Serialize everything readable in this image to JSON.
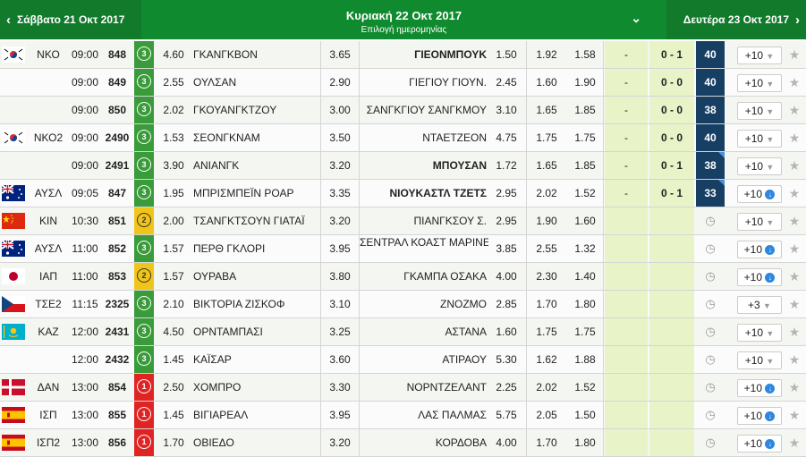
{
  "nav": {
    "prev_label": "Σάββατο 21 Οκτ 2017",
    "center_title": "Κυριακή 22 Οκτ 2017",
    "center_sub": "Επιλογή ημερομηνίας",
    "next_label": "Δευτέρα 23 Οκτ 2017",
    "prev_icon": "chevron-left-icon",
    "next_icon": "chevron-right-icon",
    "dropdown_icon": "double-chevron-down-icon"
  },
  "colors": {
    "header_green": "#0f8a2e",
    "minute_blue": "#173e63",
    "live_green": "#e8f3c8"
  },
  "rows": [
    {
      "flag": "kr",
      "league": "ΝΚΟ",
      "time": "09:00",
      "code": "848",
      "ev": "3",
      "o1": "4.60",
      "home": "ΓΚΑΝΓΚΒΟΝ",
      "ox": "3.65",
      "away": "ΓΙΕΟΝΜΠΟΥΚ",
      "away_bold": true,
      "o2": "1.50",
      "u1": "1.92",
      "u2": "1.58",
      "ht": "-",
      "score": "0 - 1",
      "minute": "40",
      "corner": false,
      "more": "+10",
      "more_type": "chevron",
      "star": "★"
    },
    {
      "flag": "",
      "league": "",
      "time": "09:00",
      "code": "849",
      "ev": "3",
      "o1": "2.55",
      "home": "ΟΥΛΣΑΝ",
      "ox": "2.90",
      "away": "ΓΙΕΓΙΟΥ ΓΙΟΥΝ.",
      "away_bold": false,
      "o2": "2.45",
      "u1": "1.60",
      "u2": "1.90",
      "ht": "-",
      "score": "0 - 0",
      "minute": "40",
      "corner": false,
      "more": "+10",
      "more_type": "chevron",
      "star": "★"
    },
    {
      "flag": "",
      "league": "",
      "time": "09:00",
      "code": "850",
      "ev": "3",
      "o1": "2.02",
      "home": "ΓΚΟΥΑΝΓΚΤΖΟΥ",
      "ox": "3.00",
      "away": "ΣΑΝΓΚΓΙΟΥ ΣΑΝΓΚΜΟΥ",
      "away_bold": false,
      "o2": "3.10",
      "u1": "1.65",
      "u2": "1.85",
      "ht": "-",
      "score": "0 - 0",
      "minute": "38",
      "corner": false,
      "more": "+10",
      "more_type": "chevron",
      "star": "★"
    },
    {
      "flag": "kr",
      "league": "ΝΚΟ2",
      "time": "09:00",
      "code": "2490",
      "ev": "3",
      "o1": "1.53",
      "home": "ΣΕΟΝΓΚΝΑΜ",
      "ox": "3.50",
      "away": "ΝΤΑΕΤΖΕΟΝ",
      "away_bold": false,
      "o2": "4.75",
      "u1": "1.75",
      "u2": "1.75",
      "ht": "-",
      "score": "0 - 0",
      "minute": "40",
      "corner": false,
      "more": "+10",
      "more_type": "chevron",
      "star": "★"
    },
    {
      "flag": "",
      "league": "",
      "time": "09:00",
      "code": "2491",
      "ev": "3",
      "o1": "3.90",
      "home": "ΑΝΙΑΝΓΚ",
      "ox": "3.20",
      "away": "ΜΠΟΥΣΑΝ",
      "away_bold": true,
      "o2": "1.72",
      "u1": "1.65",
      "u2": "1.85",
      "ht": "-",
      "score": "0 - 1",
      "minute": "38",
      "corner": true,
      "more": "+10",
      "more_type": "chevron",
      "star": "★"
    },
    {
      "flag": "au",
      "league": "ΑΥΣΛ",
      "time": "09:05",
      "code": "847",
      "ev": "3",
      "o1": "1.95",
      "home": "ΜΠΡΙΣΜΠΕΪΝ ΡΟΑΡ",
      "ox": "3.35",
      "away": "ΝΙΟΥΚΑΣΤΛ ΤΖΕΤΣ",
      "away_bold": true,
      "o2": "2.95",
      "u1": "2.02",
      "u2": "1.52",
      "ht": "-",
      "score": "0 - 1",
      "minute": "33",
      "corner": true,
      "more": "+10",
      "more_type": "info",
      "star": "★"
    },
    {
      "flag": "cn",
      "league": "ΚΙΝ",
      "time": "10:30",
      "code": "851",
      "ev": "2",
      "o1": "2.00",
      "home": "ΤΣΑΝΓΚΤΣΟΥΝ ΓΙΑΤΑΪ",
      "ox": "3.20",
      "away": "ΠΙΑΝΓΚΣΟΥ Σ.",
      "away_bold": false,
      "o2": "2.95",
      "u1": "1.90",
      "u2": "1.60",
      "ht": "",
      "score": "",
      "minute": "",
      "corner": false,
      "more": "+10",
      "more_type": "chevron",
      "star": "★"
    },
    {
      "flag": "au",
      "league": "ΑΥΣΛ",
      "time": "11:00",
      "code": "852",
      "ev": "3",
      "o1": "1.57",
      "home": "ΠΕΡΘ ΓΚΛΟΡΙ",
      "ox": "3.95",
      "away": "ΣΕΝΤΡΑΛ ΚΟΑΣΤ ΜΑΡΙΝΕΡΣ",
      "away_bold": false,
      "o2": "3.85",
      "u1": "2.55",
      "u2": "1.32",
      "ht": "",
      "score": "",
      "minute": "",
      "corner": false,
      "more": "+10",
      "more_type": "info",
      "star": "★"
    },
    {
      "flag": "jp",
      "league": "ΙΑΠ",
      "time": "11:00",
      "code": "853",
      "ev": "2",
      "o1": "1.57",
      "home": "ΟΥΡΑΒΑ",
      "ox": "3.80",
      "away": "ΓΚΑΜΠΑ ΟΣΑΚΑ",
      "away_bold": false,
      "o2": "4.00",
      "u1": "2.30",
      "u2": "1.40",
      "ht": "",
      "score": "",
      "minute": "",
      "corner": false,
      "more": "+10",
      "more_type": "info",
      "star": "★"
    },
    {
      "flag": "cz",
      "league": "ΤΣΕ2",
      "time": "11:15",
      "code": "2325",
      "ev": "3",
      "o1": "2.10",
      "home": "ΒΙΚΤΟΡΙΑ ΖΙΣΚΟΦ",
      "ox": "3.10",
      "away": "ΖΝΟΖΜΟ",
      "away_bold": false,
      "o2": "2.85",
      "u1": "1.70",
      "u2": "1.80",
      "ht": "",
      "score": "",
      "minute": "",
      "corner": false,
      "more": "+3",
      "more_type": "chevron",
      "star": "★"
    },
    {
      "flag": "kz",
      "league": "ΚΑΖ",
      "time": "12:00",
      "code": "2431",
      "ev": "3",
      "o1": "4.50",
      "home": "ΟΡΝΤΑΜΠΑΣΙ",
      "ox": "3.25",
      "away": "ΑΣΤΑΝΑ",
      "away_bold": false,
      "o2": "1.60",
      "u1": "1.75",
      "u2": "1.75",
      "ht": "",
      "score": "",
      "minute": "",
      "corner": false,
      "more": "+10",
      "more_type": "chevron",
      "star": "★"
    },
    {
      "flag": "",
      "league": "",
      "time": "12:00",
      "code": "2432",
      "ev": "3",
      "o1": "1.45",
      "home": "ΚΑΪΣΑΡ",
      "ox": "3.60",
      "away": "ΑΤΙΡΑΟΥ",
      "away_bold": false,
      "o2": "5.30",
      "u1": "1.62",
      "u2": "1.88",
      "ht": "",
      "score": "",
      "minute": "",
      "corner": false,
      "more": "+10",
      "more_type": "chevron",
      "star": "★"
    },
    {
      "flag": "dk",
      "league": "ΔΑΝ",
      "time": "13:00",
      "code": "854",
      "ev": "1",
      "o1": "2.50",
      "home": "ΧΟΜΠΡΟ",
      "ox": "3.30",
      "away": "ΝΟΡΝΤΖΕΛΑΝΤ",
      "away_bold": false,
      "o2": "2.25",
      "u1": "2.02",
      "u2": "1.52",
      "ht": "",
      "score": "",
      "minute": "",
      "corner": false,
      "more": "+10",
      "more_type": "info",
      "star": "★"
    },
    {
      "flag": "es",
      "league": "ΙΣΠ",
      "time": "13:00",
      "code": "855",
      "ev": "1",
      "o1": "1.45",
      "home": "ΒΙΓΙΑΡΕΑΛ",
      "ox": "3.95",
      "away": "ΛΑΣ ΠΑΛΜΑΣ",
      "away_bold": false,
      "o2": "5.75",
      "u1": "2.05",
      "u2": "1.50",
      "ht": "",
      "score": "",
      "minute": "",
      "corner": false,
      "more": "+10",
      "more_type": "info",
      "star": "★"
    },
    {
      "flag": "es",
      "league": "ΙΣΠ2",
      "time": "13:00",
      "code": "856",
      "ev": "1",
      "o1": "1.70",
      "home": "ΟΒΙΕΔΟ",
      "ox": "3.20",
      "away": "ΚΟΡΔΟΒΑ",
      "away_bold": false,
      "o2": "4.00",
      "u1": "1.70",
      "u2": "1.80",
      "ht": "",
      "score": "",
      "minute": "",
      "corner": false,
      "more": "+10",
      "more_type": "info",
      "star": "★"
    }
  ]
}
